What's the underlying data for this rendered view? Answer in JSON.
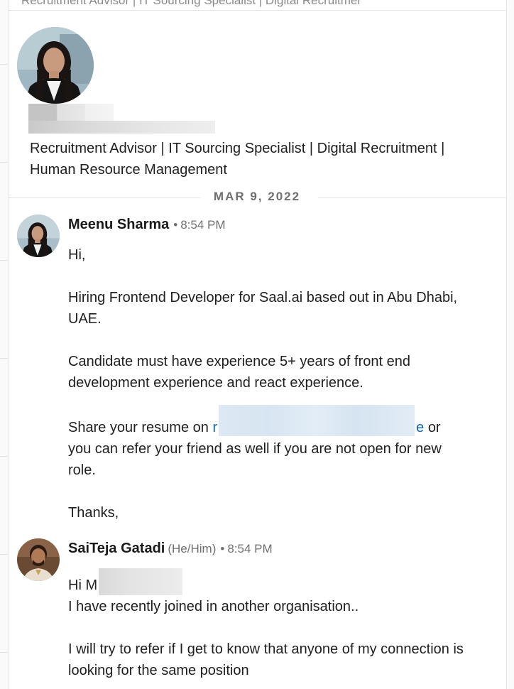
{
  "top_strip": {
    "truncated_headline": "Recruitment Advisor | IT Sourcing Specialist | Digital Recruitment"
  },
  "profile": {
    "headline": "Recruitment Advisor | IT Sourcing Specialist | Digital Recruitment | Human Resource Management"
  },
  "divider": {
    "date": "MAR 9, 2022"
  },
  "messages": [
    {
      "sender": "Meenu Sharma",
      "pronouns": "",
      "separator": "•",
      "time": "8:54 PM",
      "lines": {
        "greeting": "Hi,",
        "p1": "Hiring Frontend Developer for Saal.ai based out in Abu Dhabi, UAE.",
        "p2": "Candidate must have experience 5+ years of front end development experience and react experience.",
        "p3_start": "Share your resume on",
        "p3_link_start": "r",
        "p3_link_end": "e",
        "p3_end": "or you can refer your friend as well if you are not open for new role.",
        "sign_off": "Thanks,"
      }
    },
    {
      "sender": "SaiTeja Gatadi",
      "pronouns": "(He/Him)",
      "separator": "•",
      "time": "8:54 PM",
      "lines": {
        "greeting": "Hi M",
        "p1": "I have recently joined in another organisation..",
        "p2": "I will try to refer if I get to know that anyone of my connection is looking for the same position"
      }
    }
  ],
  "colors": {
    "link": "#0a66c2",
    "meta_gray": "#6f6f6f",
    "divider": "#e4e4e4"
  }
}
